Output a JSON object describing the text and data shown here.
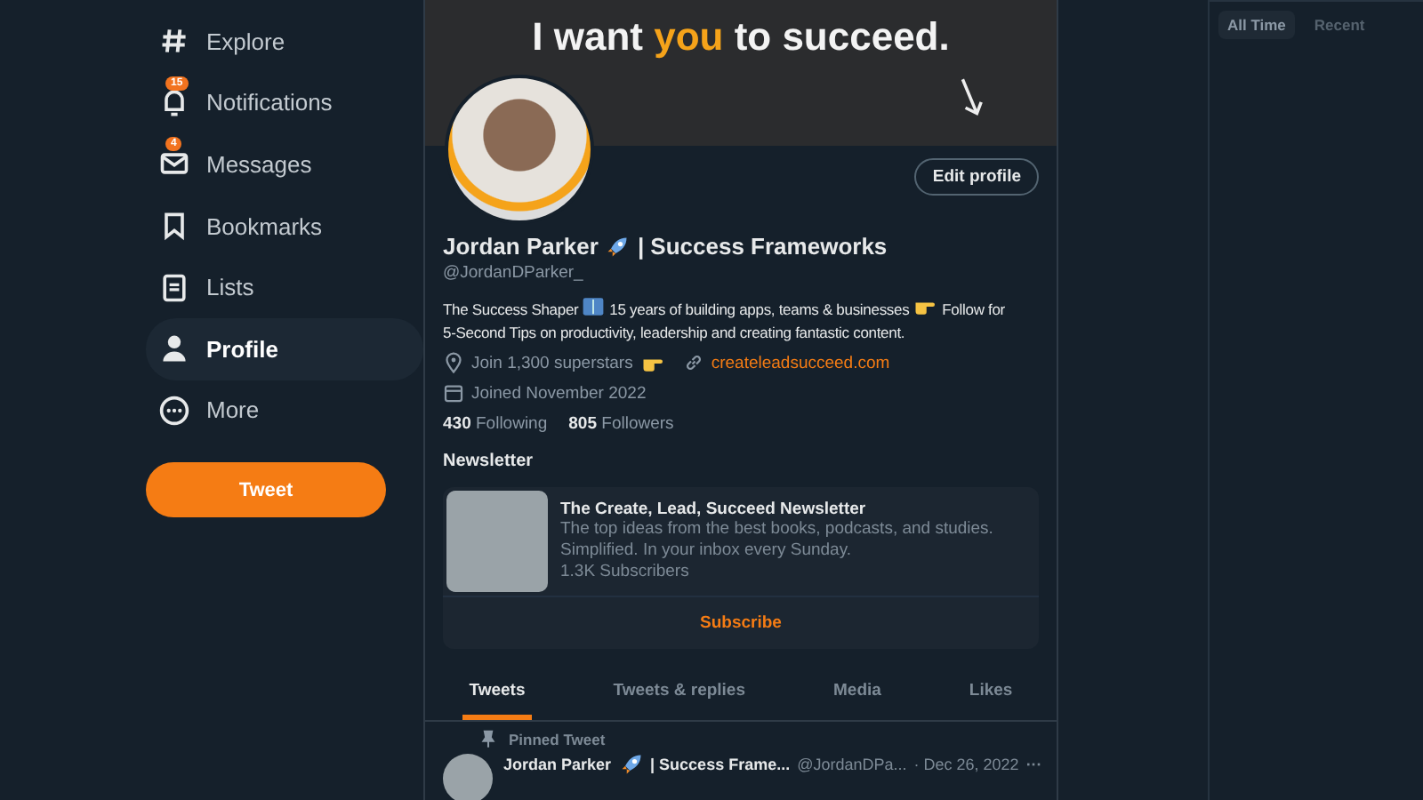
{
  "nav": [
    {
      "label": "Explore",
      "kind": "explore",
      "selected": false
    },
    {
      "label": "Notifications",
      "kind": "bell",
      "badge": "15",
      "selected": false
    },
    {
      "label": "Messages",
      "kind": "mail",
      "badge": "4",
      "selected": false
    },
    {
      "label": "Bookmarks",
      "kind": "bookmark",
      "selected": false
    },
    {
      "label": "Lists",
      "kind": "list",
      "selected": false
    },
    {
      "label": "Profile",
      "kind": "person",
      "selected": true
    },
    {
      "label": "More",
      "kind": "more",
      "selected": false
    }
  ],
  "tweet_button": "Tweet",
  "banner": {
    "text": "I want *you* to succeed."
  },
  "profile": {
    "edit_button": "Edit profile",
    "name_parts": [
      "Jordan Parker",
      "| Success Frameworks"
    ],
    "handle": "@JordanDParker_",
    "bio": [
      "The Success Shaper",
      "15 years of building apps, teams & businesses",
      "Follow for",
      "5-Second Tips on productivity, leadership and creating fantastic content."
    ],
    "location": "Join 1,300 superstars",
    "website": "createleadsucceed.com",
    "joined": "Joined November 2022",
    "following_count": "430",
    "following_label": "Following",
    "followers_count": "805",
    "followers_label": "Followers"
  },
  "newsletter": {
    "heading": "Newsletter",
    "title": "The Create, Lead, Succeed Newsletter",
    "description": "The top ideas from the best books, podcasts, and studies. Simplified. In your inbox every Sunday.",
    "subscribers": "1.3K Subscribers",
    "button": "Subscribe"
  },
  "tabs": [
    {
      "label": "Tweets",
      "selected": true
    },
    {
      "label": "Tweets & replies",
      "selected": false
    },
    {
      "label": "Media",
      "selected": false
    },
    {
      "label": "Likes",
      "selected": false
    }
  ],
  "pinned_tweet": {
    "label": "Pinned Tweet",
    "name_parts": [
      "Jordan Parker",
      "| Success Frame..."
    ],
    "handle": "@JordanDPa...",
    "date": "· Dec 26, 2022",
    "more": "···"
  },
  "right_tabs": [
    {
      "label": "All Time",
      "selected": true
    },
    {
      "label": "Recent",
      "selected": false
    }
  ]
}
